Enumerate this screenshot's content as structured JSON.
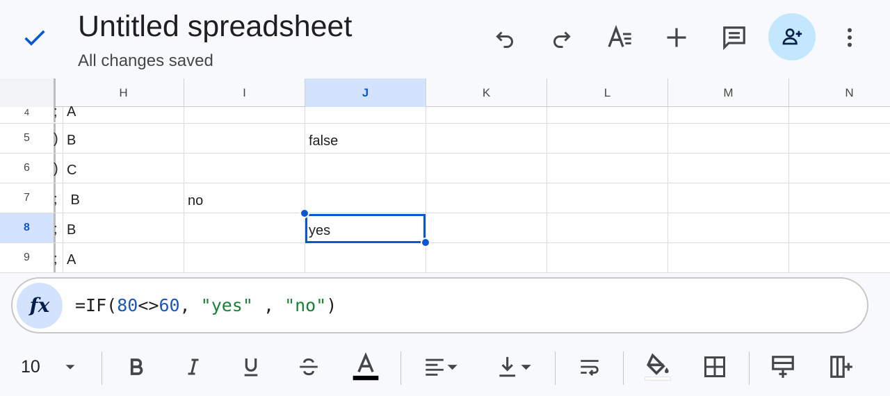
{
  "header": {
    "title": "Untitled spreadsheet",
    "status": "All changes saved",
    "icons": [
      "check-icon",
      "undo-icon",
      "redo-icon",
      "text-format-icon",
      "add-icon",
      "comment-icon",
      "share-person-add-icon",
      "more-vert-icon"
    ]
  },
  "grid": {
    "columns": [
      "H",
      "I",
      "J",
      "K",
      "L",
      "M",
      "N"
    ],
    "active_column": "J",
    "rows": [
      "4",
      "5",
      "6",
      "7",
      "8",
      "9"
    ],
    "active_row": "8",
    "cells": {
      "h4": "A",
      "h5": "B",
      "h6": "C",
      "h7": " B",
      "h8": "B",
      "h9": "A",
      "i7": "no",
      "j5": "false",
      "j8": "yes"
    },
    "g_fragments": {
      "r4": ";",
      "r5": ")",
      "r6": ")",
      "r7": ";",
      "r8": ";",
      "r9": ";"
    }
  },
  "formula_bar": {
    "fx_label": "fx",
    "parts": {
      "p1": "=IF(",
      "p2": "80",
      "p3": "<>",
      "p4": "60",
      "p5": ", ",
      "p6": "\"yes\"",
      "p7": " , ",
      "p8": "\"no\"",
      "p9": ")"
    }
  },
  "toolbar": {
    "font_size": "10",
    "icons": [
      "font-size-dropdown-icon",
      "bold-icon",
      "italic-icon",
      "underline-icon",
      "strikethrough-icon",
      "text-color-icon",
      "align-left-icon",
      "vertical-align-icon",
      "wrap-text-icon",
      "fill-color-icon",
      "borders-icon",
      "insert-row-icon",
      "insert-column-icon"
    ]
  },
  "colors": {
    "accent": "#0b57d0",
    "active_header": "#d3e3fd",
    "share_bg": "#c2e7ff",
    "formula_number": "#1a57b8",
    "formula_string": "#188038"
  }
}
